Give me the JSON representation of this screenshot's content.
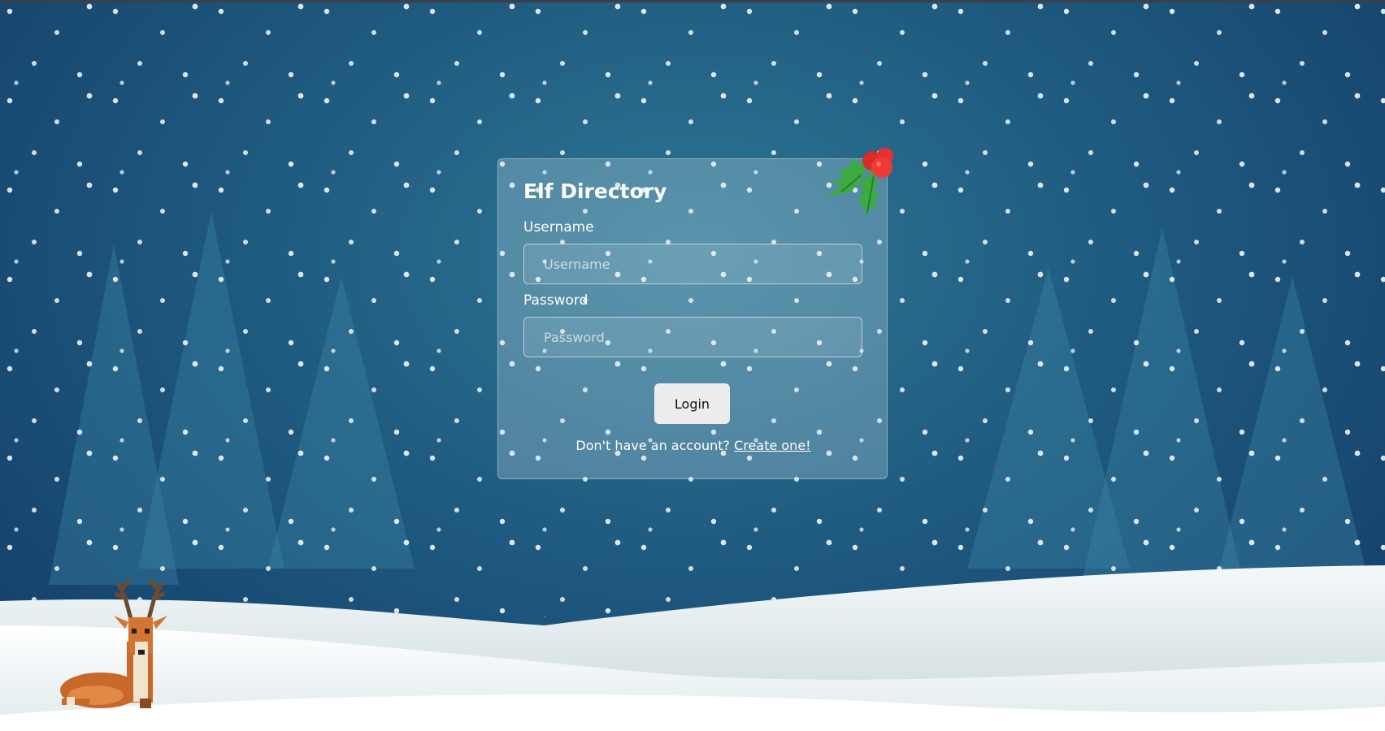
{
  "login_card": {
    "title": "Elf Directory",
    "username_label": "Username",
    "username_placeholder": "Username",
    "username_value": "",
    "password_label": "Password",
    "password_placeholder": "Password",
    "password_value": "",
    "login_button": "Login",
    "signup_prompt": "Don't have an account?",
    "signup_link": "Create one!"
  },
  "decorations": {
    "holly": "holly-icon",
    "reindeer": "reindeer-icon"
  },
  "colors": {
    "sky_top": "#123c68",
    "sky_center": "#2e7695",
    "snow": "#ffffff",
    "card_text": "#ffffff",
    "button_bg": "#ededed",
    "holly_leaf": "#3cab3f",
    "holly_berry": "#e8312e"
  }
}
